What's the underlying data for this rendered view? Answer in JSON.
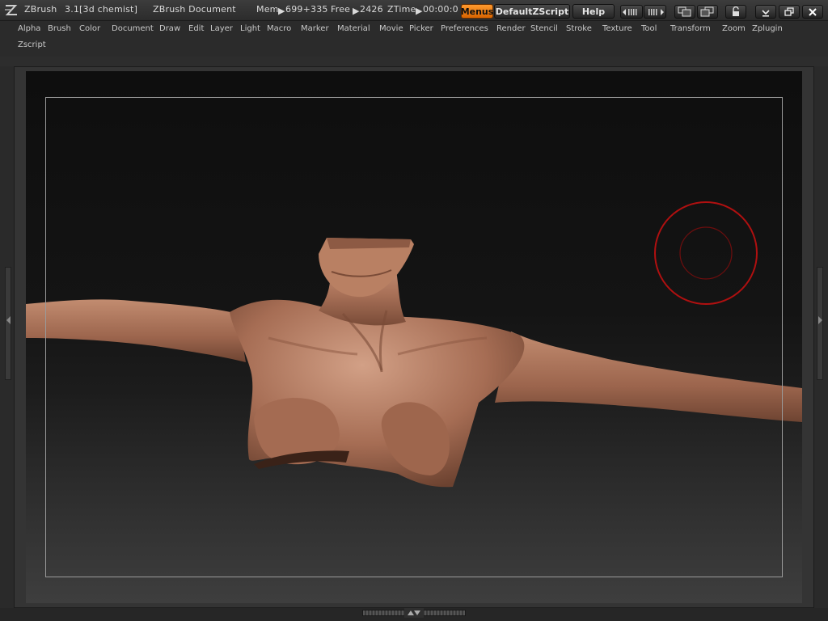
{
  "titlebar": {
    "app_name": "ZBrush",
    "version": "3.1",
    "user": "[3d chemist]",
    "document": "ZBrush Document",
    "mem_label": "Mem",
    "mem_value": "699+335",
    "free_label": "Free",
    "free_value": "2426",
    "ztime_label": "ZTime",
    "ztime_value": "00:00:0",
    "menus_button": "Menus",
    "zscript_button": "DefaultZScript",
    "help_button": "Help"
  },
  "menu": {
    "items": [
      "Alpha",
      "Brush",
      "Color",
      "Document",
      "Draw",
      "Edit",
      "Layer",
      "Light",
      "Macro",
      "Marker",
      "Material",
      "Movie",
      "Picker",
      "Preferences",
      "Render",
      "Stencil",
      "Stroke",
      "Texture",
      "Tool",
      "Transform",
      "Zoom",
      "Zplugin",
      "Zscript"
    ]
  },
  "icons": {
    "logo": "zbrush-logo-icon",
    "scroll_left": "palette-scroll-left-icon",
    "scroll_right": "palette-scroll-right-icon",
    "layout_a": "ui-layout-icon",
    "layout_b": "ui-layout-alt-icon",
    "lock": "lock-icon",
    "minimize": "minimize-icon",
    "restore": "restore-icon",
    "close": "close-icon"
  },
  "colors": {
    "accent": "#f07d10",
    "brush_ring": "#b01010",
    "skin": "#b07a5e"
  }
}
